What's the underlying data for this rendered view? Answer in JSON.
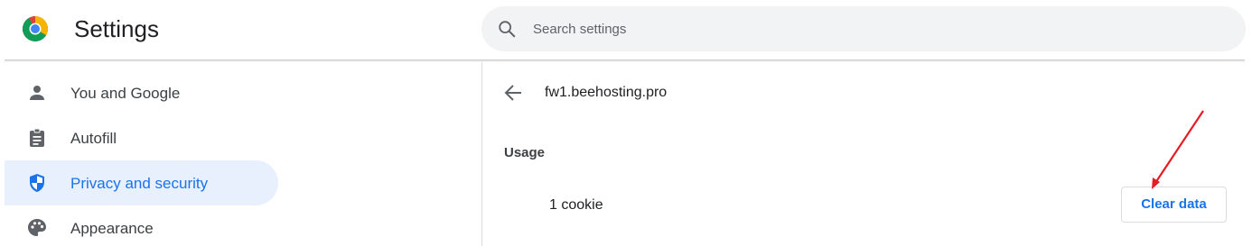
{
  "header": {
    "title": "Settings",
    "logo_icon": "chrome-logo",
    "search": {
      "placeholder": "Search settings",
      "icon": "search-icon"
    }
  },
  "sidebar": {
    "items": [
      {
        "label": "You and Google",
        "icon": "person-icon",
        "active": false
      },
      {
        "label": "Autofill",
        "icon": "clipboard-icon",
        "active": false
      },
      {
        "label": "Privacy and security",
        "icon": "shield-icon",
        "active": true
      },
      {
        "label": "Appearance",
        "icon": "palette-icon",
        "active": false
      }
    ]
  },
  "main": {
    "site": "fw1.beehosting.pro",
    "usage_label": "Usage",
    "cookie_count_text": "1 cookie",
    "clear_button_label": "Clear data"
  },
  "colors": {
    "accent": "#1a73e8",
    "active_bg": "#e8f0fe",
    "annotation_arrow": "#e51c23"
  }
}
